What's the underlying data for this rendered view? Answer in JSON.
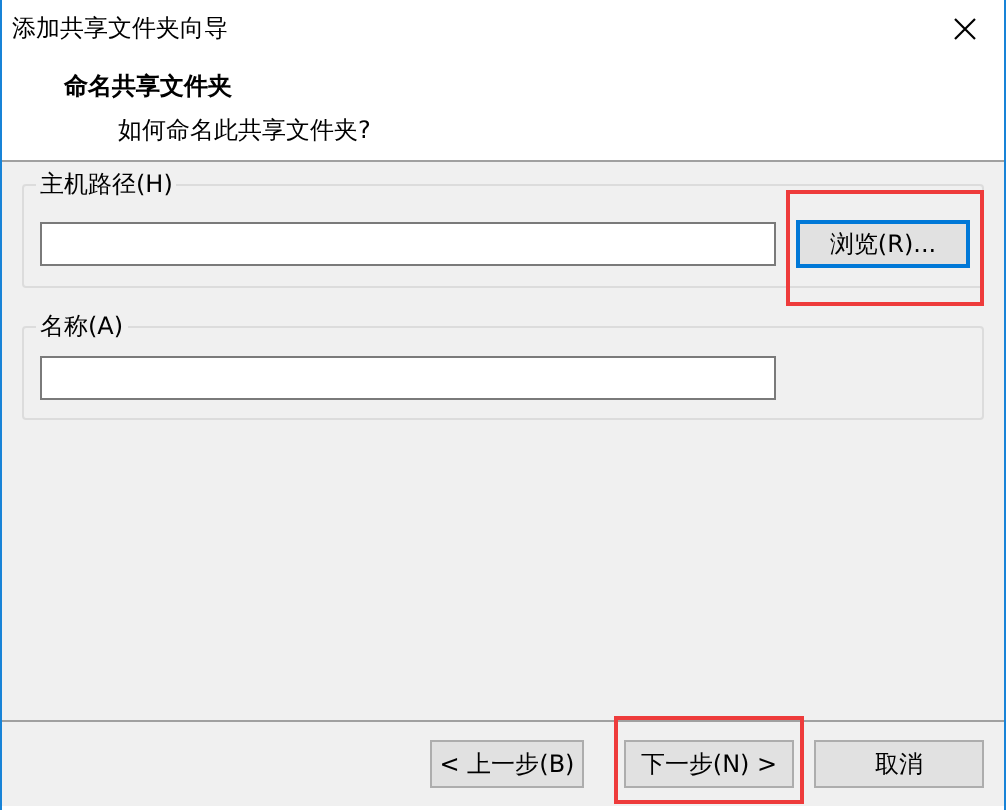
{
  "window": {
    "title": "添加共享文件夹向导"
  },
  "header": {
    "title": "命名共享文件夹",
    "subtitle": "如何命名此共享文件夹?"
  },
  "groups": [
    {
      "label": "主机路径(H)",
      "button": {
        "label": "浏览(R)...",
        "focused": true,
        "highlighted": true
      }
    },
    {
      "label": "名称(A)"
    }
  ],
  "buttons": [
    {
      "label": "< 上一步(B)",
      "highlighted": false
    },
    {
      "label": "下一步(N) >",
      "highlighted": true
    },
    {
      "label": "取消",
      "highlighted": false
    }
  ]
}
